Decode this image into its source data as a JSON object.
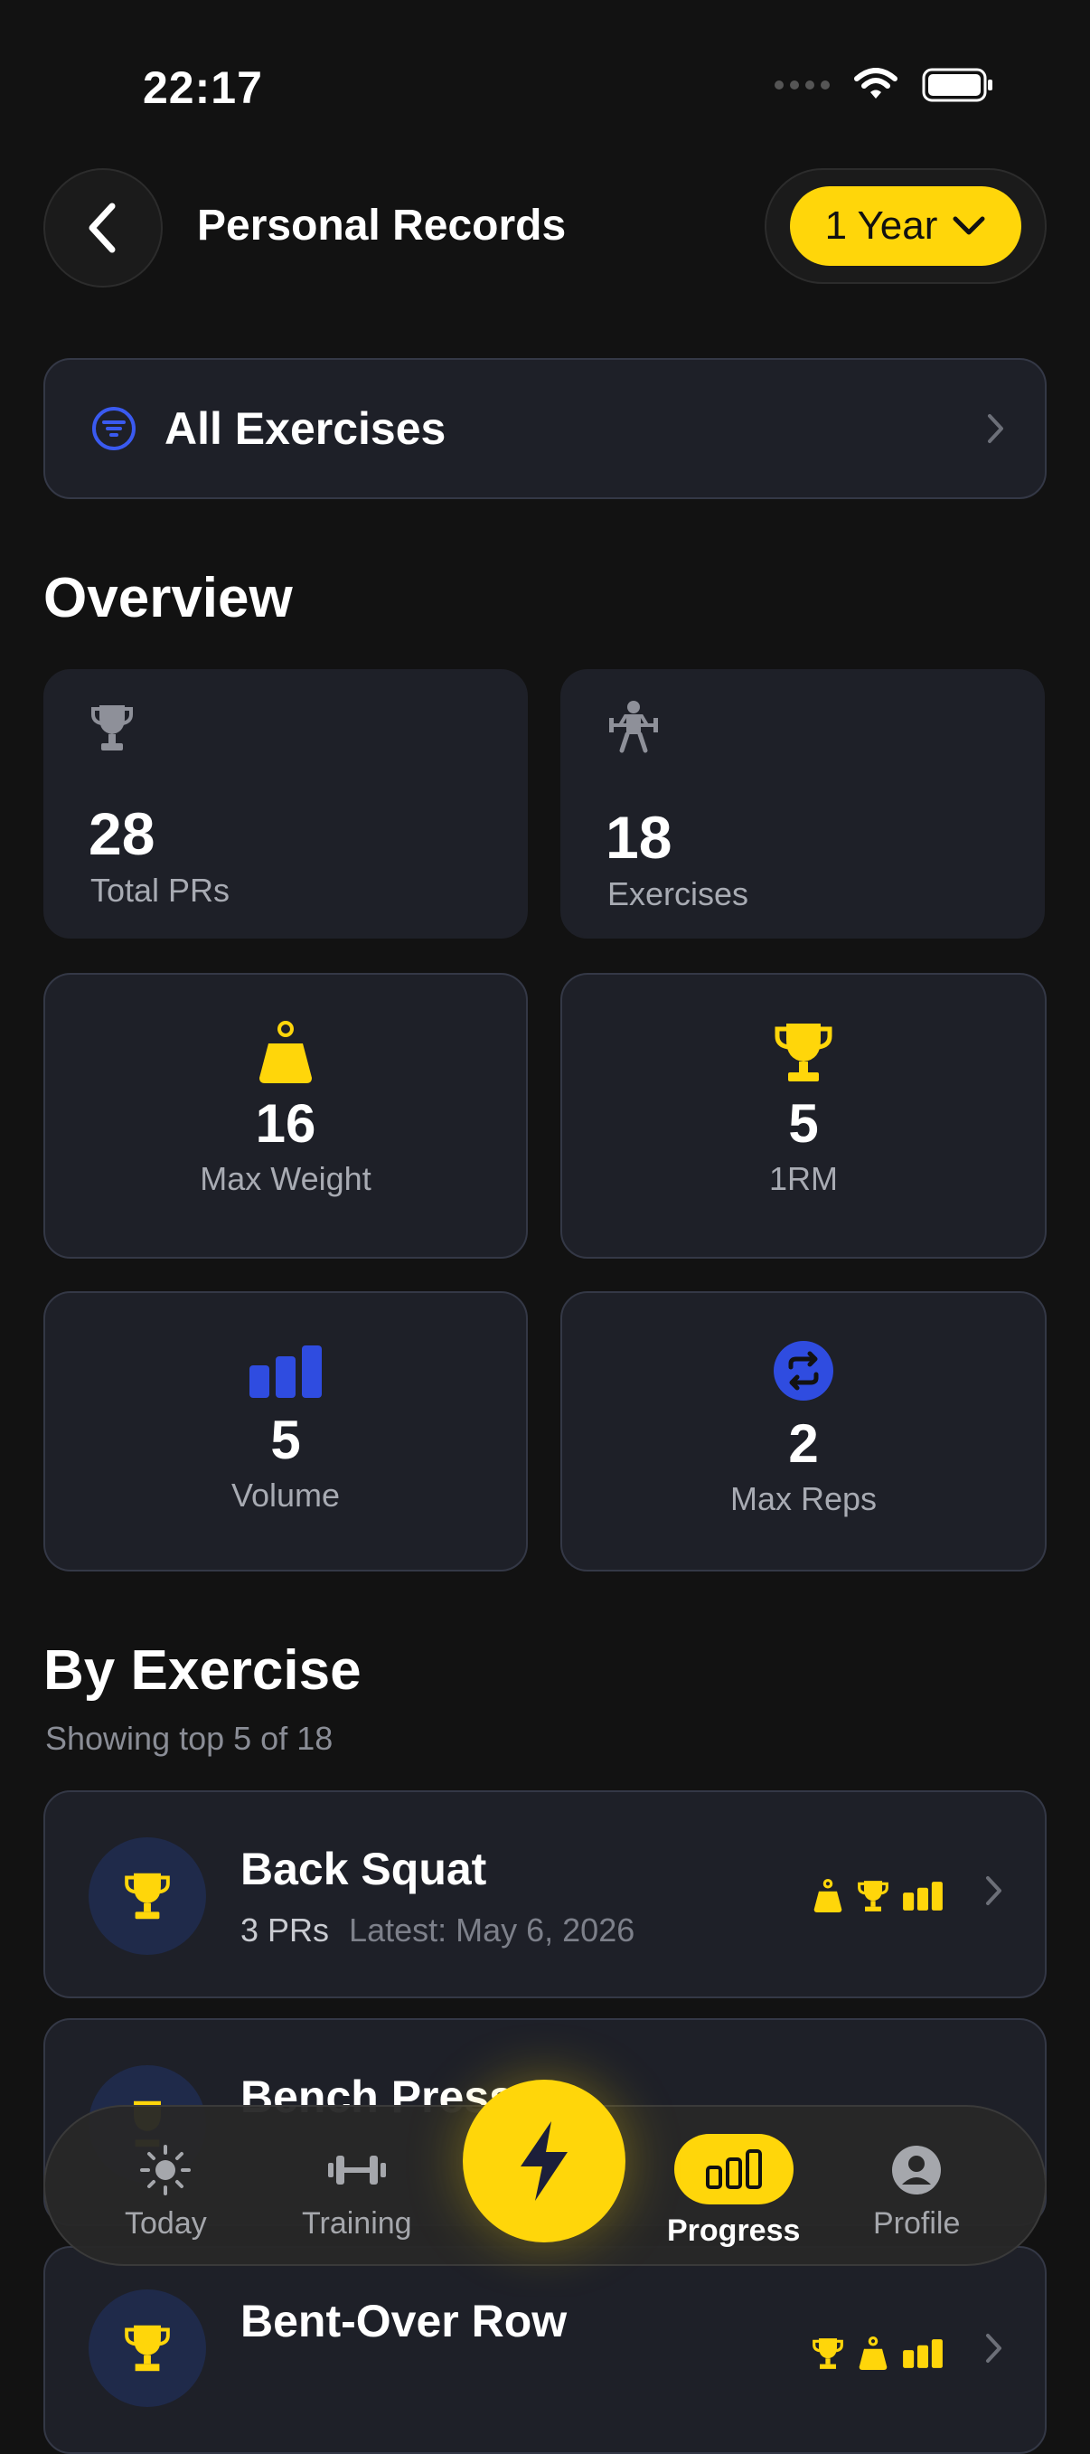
{
  "status": {
    "time": "22:17"
  },
  "header": {
    "title": "Personal Records",
    "period": "1 Year"
  },
  "filter": {
    "label": "All Exercises"
  },
  "overview": {
    "title": "Overview",
    "total_prs": {
      "value": "28",
      "label": "Total PRs"
    },
    "exercises": {
      "value": "18",
      "label": "Exercises"
    },
    "max_weight": {
      "value": "16",
      "label": "Max Weight"
    },
    "one_rm": {
      "value": "5",
      "label": "1RM"
    },
    "volume": {
      "value": "5",
      "label": "Volume"
    },
    "max_reps": {
      "value": "2",
      "label": "Max Reps"
    }
  },
  "by_exercise": {
    "title": "By Exercise",
    "subtitle": "Showing top 5 of 18",
    "items": [
      {
        "name": "Back Squat",
        "prs": "3 PRs",
        "latest": "Latest: May 6, 2026"
      },
      {
        "name": "Bench Press"
      },
      {
        "name": "Bent-Over Row"
      }
    ]
  },
  "tabs": {
    "today": "Today",
    "training": "Training",
    "progress": "Progress",
    "profile": "Profile"
  },
  "colors": {
    "accent": "#ffd60a",
    "blue": "#2f4ce0",
    "card": "#1e2028",
    "bg": "#121212"
  }
}
